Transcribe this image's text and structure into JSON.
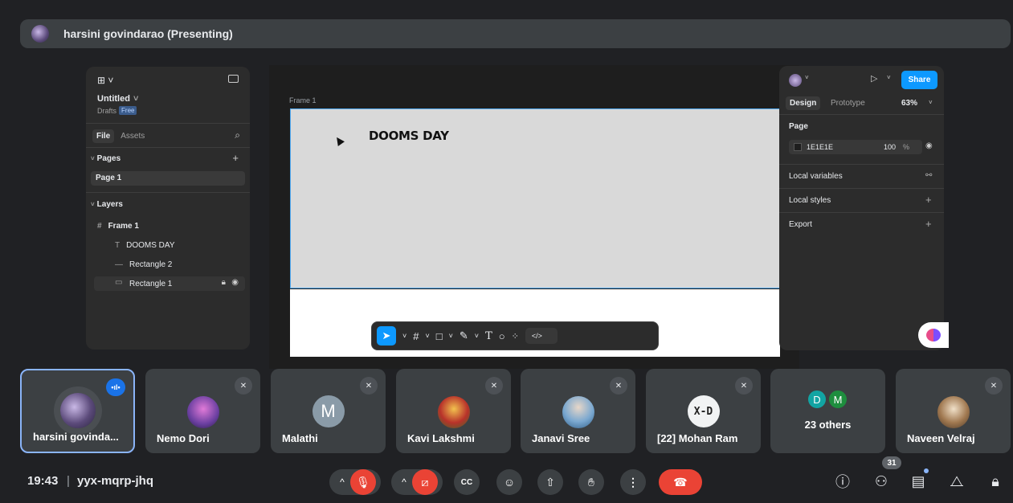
{
  "presenter": {
    "title": "harsini govindarao (Presenting)"
  },
  "figma": {
    "file_title": "Untitled",
    "drafts": "Drafts",
    "plan_badge": "Free",
    "tabs": {
      "file": "File",
      "assets": "Assets"
    },
    "pages_header": "Pages",
    "page_item": "Page 1",
    "layers_header": "Layers",
    "layers": [
      "Frame 1",
      "DOOMS DAY",
      "Rectangle 2",
      "Rectangle 1"
    ],
    "frame_label": "Frame 1",
    "frame_text": "DOOMS DAY",
    "right": {
      "share": "Share",
      "tab_design": "Design",
      "tab_prototype": "Prototype",
      "zoom": "63%",
      "page_header": "Page",
      "page_color": "1E1E1E",
      "page_opacity": "100",
      "percent": "%",
      "local_variables": "Local variables",
      "local_styles": "Local styles",
      "export": "Export"
    },
    "toolbar": {
      "dev_mode": "</>"
    }
  },
  "participants": [
    {
      "name": "harsini govinda...",
      "speaking": true
    },
    {
      "name": "Nemo Dori",
      "muted": true
    },
    {
      "name": "Malathi",
      "initial": "M",
      "muted": true
    },
    {
      "name": "Kavi Lakshmi",
      "muted": true
    },
    {
      "name": "Janavi Sree",
      "muted": true
    },
    {
      "name": "[22] Mohan Ram",
      "avatar_text": "X-D",
      "muted": true
    },
    {
      "name": "23 others",
      "initials": [
        "D",
        "M"
      ]
    },
    {
      "name": "Naveen Velraj",
      "muted": true
    }
  ],
  "meeting": {
    "time": "19:43",
    "separator": "|",
    "code": "yyx-mqrp-jhq",
    "people_count": "31"
  },
  "colors": {
    "accent": "#8ab4f8",
    "danger": "#ea4335",
    "figma_blue": "#0d99ff"
  }
}
